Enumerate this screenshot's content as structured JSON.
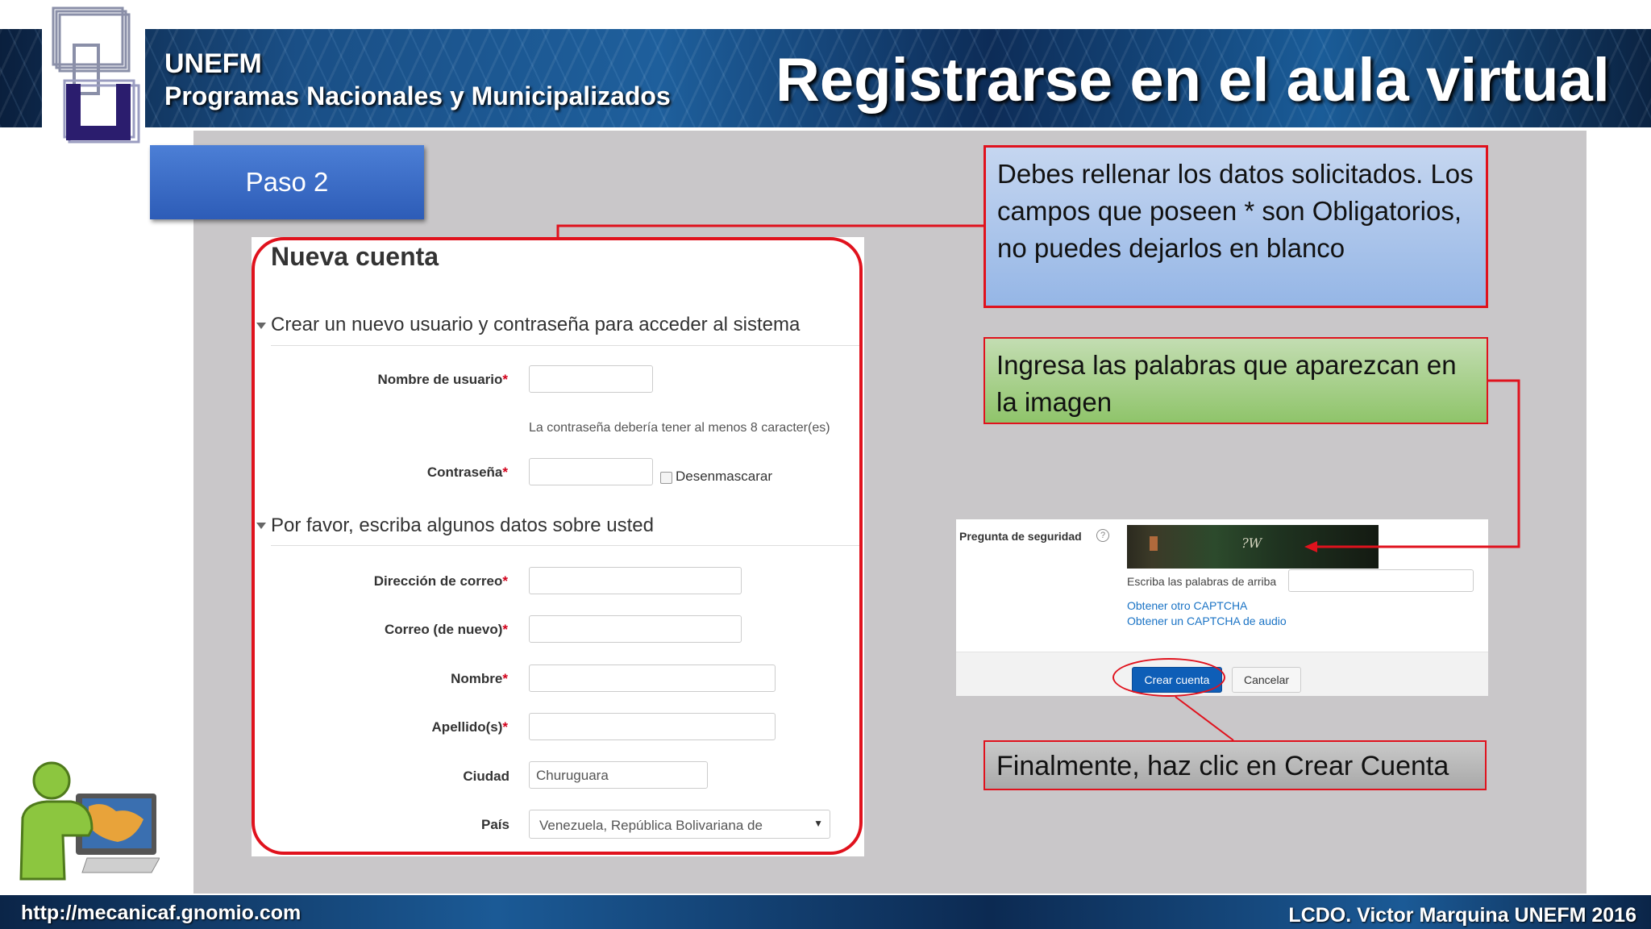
{
  "header": {
    "org_name": "UNEFM",
    "org_subtitle": "Programas Nacionales y Municipalizados",
    "slide_title": "Registrarse en el aula virtual"
  },
  "step": {
    "label": "Paso 2"
  },
  "form": {
    "title": "Nueva cuenta",
    "section1": "Crear un nuevo usuario y contraseña para acceder al sistema",
    "username_label": "Nombre de usuario",
    "password_hint": "La contraseña debería tener al menos 8 caracter(es)",
    "password_label": "Contraseña",
    "unmask_label": "Desenmascarar",
    "section2": "Por favor, escriba algunos datos sobre usted",
    "email_label": "Dirección de correo",
    "email2_label": "Correo (de nuevo)",
    "firstname_label": "Nombre",
    "lastname_label": "Apellido(s)",
    "city_label": "Ciudad",
    "city_value": "Churuguara",
    "country_label": "País",
    "country_value": "Venezuela, República Bolivariana de",
    "required_mark": "*"
  },
  "callouts": {
    "blue": "Debes rellenar los datos solicitados. Los campos que poseen * son Obligatorios, no puedes dejarlos en blanco",
    "green": "Ingresa las palabras que aparezcan en la imagen",
    "grey": "Finalmente, haz clic en Crear Cuenta"
  },
  "captcha": {
    "label": "Pregunta de seguridad",
    "help": "?",
    "word": "?W",
    "hint": "Escriba las palabras de arriba",
    "link_other": "Obtener otro CAPTCHA",
    "link_audio": "Obtener un CAPTCHA de audio",
    "create_button": "Crear cuenta",
    "cancel_button": "Cancelar"
  },
  "footer": {
    "url": "http://mecanicaf.gnomio.com",
    "author": "LCDO. Victor Marquina UNEFM 2016"
  },
  "colors": {
    "accent_red": "#e0121d",
    "step_blue": "#3b6ac7",
    "button_blue": "#0e5eb7",
    "link_blue": "#1a73c5"
  }
}
